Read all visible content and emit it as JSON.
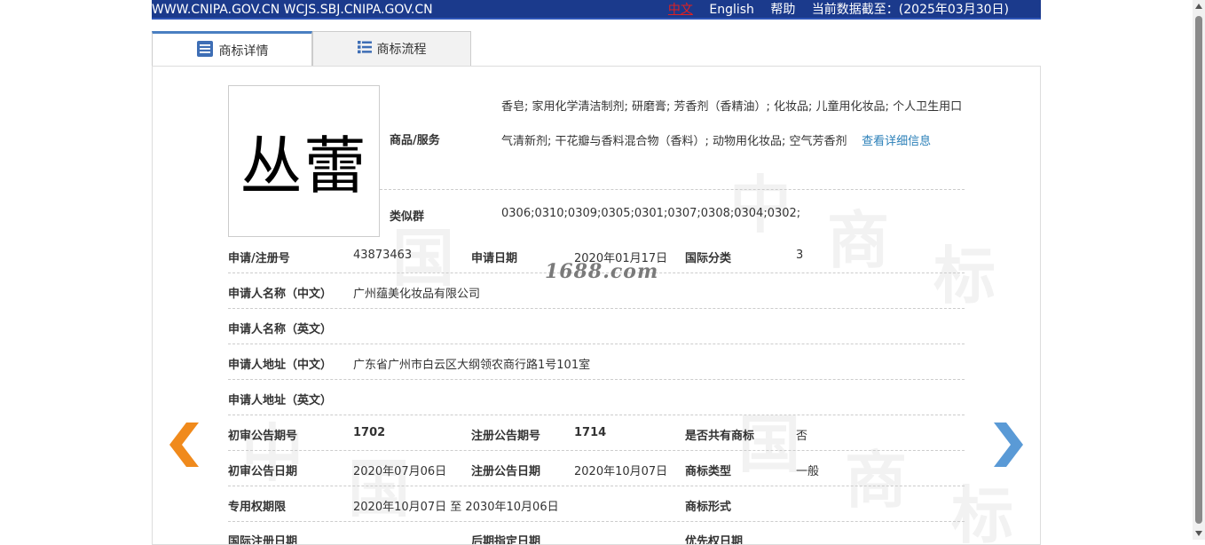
{
  "topbar": {
    "sites": "WWW.CNIPA.GOV.CN WCJS.SBJ.CNIPA.GOV.CN",
    "zh": "中文",
    "english": "English",
    "help": "帮助",
    "data_as_of": "当前数据截至：(2025年03月30日)"
  },
  "tabs": [
    {
      "label": "商标详情",
      "icon": "document-list-icon"
    },
    {
      "label": "商标流程",
      "icon": "list-icon"
    }
  ],
  "trademark": {
    "logo_text": "丛蕾",
    "goods_label": "商品/服务",
    "goods_text": "香皂; 家用化学清洁制剂; 研磨膏; 芳香剂（香精油）; 化妆品; 儿童用化妆品; 个人卫生用口气清新剂; 干花瓣与香料混合物（香料）; 动物用化妆品; 空气芳香剂",
    "goods_more": "查看详细信息",
    "similar_label": "类似群",
    "similar_value": "0306;0310;0309;0305;0301;0307;0308;0304;0302;"
  },
  "fields": {
    "reg_no_label": "申请/注册号",
    "reg_no": "43873463",
    "apply_date_label": "申请日期",
    "apply_date": "2020年01月17日",
    "intl_class_label": "国际分类",
    "intl_class": "3",
    "applicant_cn_label": "申请人名称（中文）",
    "applicant_cn": "广州蕴美化妆品有限公司",
    "applicant_en_label": "申请人名称（英文）",
    "applicant_en": "",
    "address_cn_label": "申请人地址（中文）",
    "address_cn": "广东省广州市白云区大纲领农商行路1号101室",
    "address_en_label": "申请人地址（英文）",
    "address_en": "",
    "prelim_no_label": "初审公告期号",
    "prelim_no": "1702",
    "reg_pub_no_label": "注册公告期号",
    "reg_pub_no": "1714",
    "shared_label": "是否共有商标",
    "shared": "否",
    "prelim_date_label": "初审公告日期",
    "prelim_date": "2020年07月06日",
    "reg_pub_date_label": "注册公告日期",
    "reg_pub_date": "2020年10月07日",
    "tm_type_label": "商标类型",
    "tm_type": "一般",
    "exclusive_label": "专用权期限",
    "exclusive": "2020年10月07日 至 2030年10月06日",
    "tm_form_label": "商标形式",
    "tm_form": "",
    "intl_reg_date_label": "国际注册日期",
    "later_date_label": "后期指定日期",
    "priority_date_label": "优先权日期"
  },
  "watermark_1688": "1688.com",
  "watermark_chars": [
    "中",
    "国",
    "商",
    "标"
  ],
  "colors": {
    "topbar": "#1b3a8c",
    "link": "#2a7fb8",
    "arrow_prev": "#f08a1c",
    "arrow_next": "#5a9ad6"
  }
}
